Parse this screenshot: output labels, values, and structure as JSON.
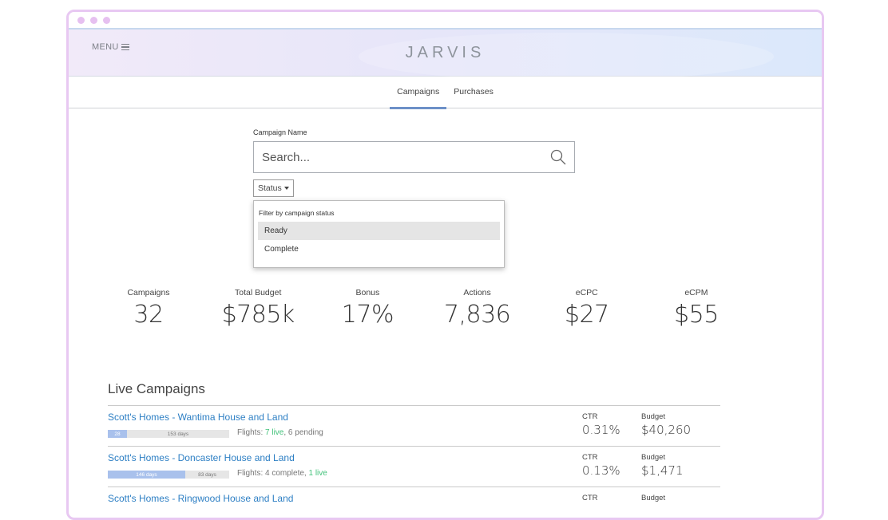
{
  "app": {
    "brand": "JARVIS",
    "menu_label": "MENU"
  },
  "tabs": [
    {
      "label": "Campaigns",
      "active": true
    },
    {
      "label": "Purchases",
      "active": false
    }
  ],
  "search": {
    "label": "Campaign Name",
    "placeholder": "Search..."
  },
  "status_filter": {
    "button_label": "Status",
    "title": "Filter by campaign status",
    "options": [
      {
        "label": "Ready",
        "highlighted": true
      },
      {
        "label": "Complete",
        "highlighted": false
      }
    ]
  },
  "stats": [
    {
      "label": "Campaigns",
      "value": "32"
    },
    {
      "label": "Total Budget",
      "value": "$785k"
    },
    {
      "label": "Bonus",
      "value": "17%"
    },
    {
      "label": "Actions",
      "value": "7,836"
    },
    {
      "label": "eCPC",
      "value": "$27"
    },
    {
      "label": "eCPM",
      "value": "$55"
    }
  ],
  "live": {
    "title": "Live Campaigns",
    "rows": [
      {
        "name": "Scott's Homes - Wantima House and Land",
        "days_elapsed": "28",
        "days_remaining": "153 days",
        "progress_fraction": 0.155,
        "flights_prefix": "Flights: ",
        "flights_green": "7 live",
        "flights_suffix": ", 6 pending",
        "ctr_label": "CTR",
        "ctr": "0.31%",
        "budget_label": "Budget",
        "budget": "$40,260"
      },
      {
        "name": "Scott's Homes - Doncaster House and Land",
        "days_elapsed": "146 days",
        "days_remaining": "83 days",
        "progress_fraction": 0.638,
        "flights_prefix": "Flights: 4 complete, ",
        "flights_green": "1 live",
        "flights_suffix": "",
        "ctr_label": "CTR",
        "ctr": "0.13%",
        "budget_label": "Budget",
        "budget": "$1,471"
      },
      {
        "name": "Scott's Homes - Ringwood House and Land",
        "days_elapsed": "",
        "days_remaining": "",
        "progress_fraction": 0,
        "flights_prefix": "",
        "flights_green": "",
        "flights_suffix": "",
        "ctr_label": "CTR",
        "ctr": "",
        "budget_label": "Budget",
        "budget": ""
      }
    ]
  }
}
